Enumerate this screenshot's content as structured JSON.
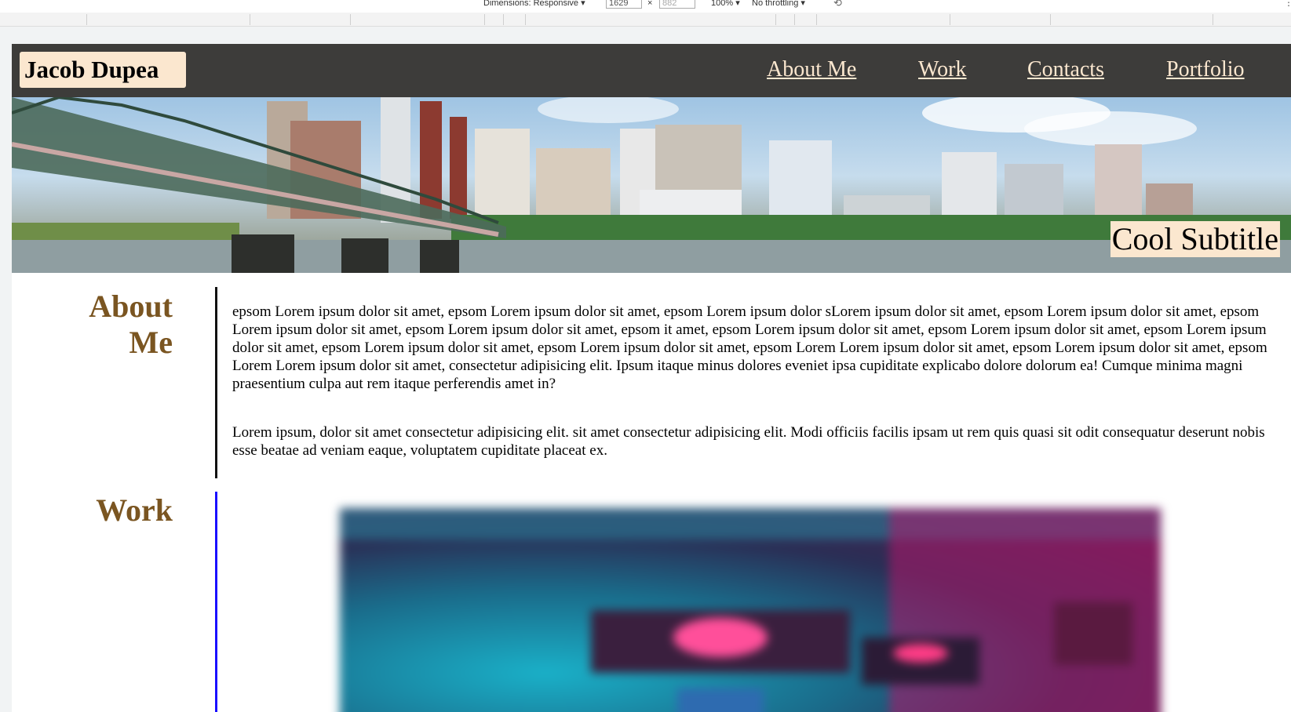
{
  "devtools": {
    "dimensions_label": "Dimensions: Responsive ▾",
    "width": "1629",
    "height": "882",
    "times": "×",
    "zoom": "100% ▾",
    "throttle": "No throttling ▾",
    "rotate_icon": "⟲",
    "more_icon": "⋮"
  },
  "header": {
    "logo": "Jacob Dupea",
    "nav": [
      "About Me",
      "Work",
      "Contacts",
      "Portfolio"
    ]
  },
  "hero": {
    "subtitle": "Cool Subtitle"
  },
  "about": {
    "title": "About Me",
    "paragraphs": [
      "epsom Lorem ipsum dolor sit amet, epsom Lorem ipsum dolor sit amet, epsom Lorem ipsum dolor sLorem ipsum dolor sit amet, epsom Lorem ipsum dolor sit amet, epsom Lorem ipsum dolor sit amet, epsom Lorem ipsum dolor sit amet, epsom it amet, epsom Lorem ipsum dolor sit amet, epsom Lorem ipsum dolor sit amet, epsom Lorem ipsum dolor sit amet, epsom Lorem ipsum dolor sit amet, epsom Lorem ipsum dolor sit amet, epsom Lorem Lorem ipsum dolor sit amet, epsom Lorem ipsum dolor sit amet, epsom Lorem Lorem ipsum dolor sit amet, consectetur adipisicing elit. Ipsum itaque minus dolores eveniet ipsa cupiditate explicabo dolore dolorum ea! Cumque minima magni praesentium culpa aut rem itaque perferendis amet in?",
      "Lorem ipsum, dolor sit amet consectetur adipisicing elit. sit amet consectetur adipisicing elit. Modi officiis facilis ipsam ut rem quis quasi sit odit consequatur deserunt nobis esse beatae ad veniam eaque, voluptatem cupiditate placeat ex."
    ]
  },
  "work": {
    "title": "Work"
  },
  "colors": {
    "header_bg": "#3d3c3a",
    "accent_cream": "#fbe7cf",
    "section_title": "#7a5521",
    "work_rule": "#1a0fff"
  }
}
